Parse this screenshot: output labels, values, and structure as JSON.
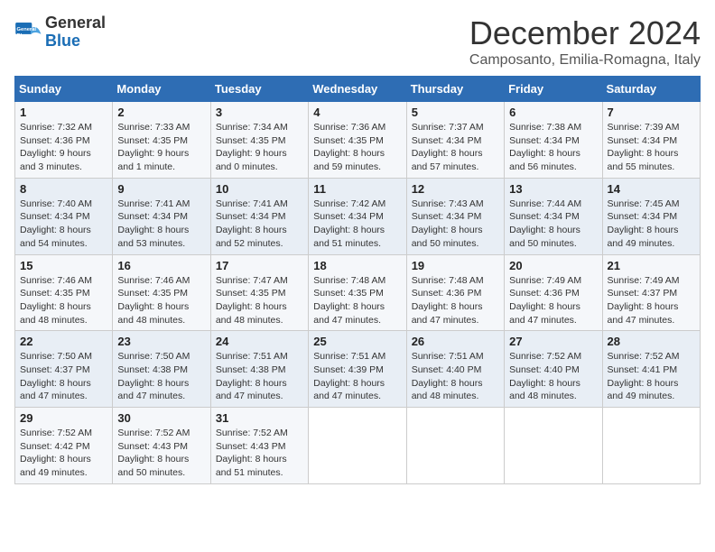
{
  "header": {
    "logo_line1": "General",
    "logo_line2": "Blue",
    "month": "December 2024",
    "location": "Camposanto, Emilia-Romagna, Italy"
  },
  "weekdays": [
    "Sunday",
    "Monday",
    "Tuesday",
    "Wednesday",
    "Thursday",
    "Friday",
    "Saturday"
  ],
  "weeks": [
    [
      {
        "day": "1",
        "info": "Sunrise: 7:32 AM\nSunset: 4:36 PM\nDaylight: 9 hours\nand 3 minutes."
      },
      {
        "day": "2",
        "info": "Sunrise: 7:33 AM\nSunset: 4:35 PM\nDaylight: 9 hours\nand 1 minute."
      },
      {
        "day": "3",
        "info": "Sunrise: 7:34 AM\nSunset: 4:35 PM\nDaylight: 9 hours\nand 0 minutes."
      },
      {
        "day": "4",
        "info": "Sunrise: 7:36 AM\nSunset: 4:35 PM\nDaylight: 8 hours\nand 59 minutes."
      },
      {
        "day": "5",
        "info": "Sunrise: 7:37 AM\nSunset: 4:34 PM\nDaylight: 8 hours\nand 57 minutes."
      },
      {
        "day": "6",
        "info": "Sunrise: 7:38 AM\nSunset: 4:34 PM\nDaylight: 8 hours\nand 56 minutes."
      },
      {
        "day": "7",
        "info": "Sunrise: 7:39 AM\nSunset: 4:34 PM\nDaylight: 8 hours\nand 55 minutes."
      }
    ],
    [
      {
        "day": "8",
        "info": "Sunrise: 7:40 AM\nSunset: 4:34 PM\nDaylight: 8 hours\nand 54 minutes."
      },
      {
        "day": "9",
        "info": "Sunrise: 7:41 AM\nSunset: 4:34 PM\nDaylight: 8 hours\nand 53 minutes."
      },
      {
        "day": "10",
        "info": "Sunrise: 7:41 AM\nSunset: 4:34 PM\nDaylight: 8 hours\nand 52 minutes."
      },
      {
        "day": "11",
        "info": "Sunrise: 7:42 AM\nSunset: 4:34 PM\nDaylight: 8 hours\nand 51 minutes."
      },
      {
        "day": "12",
        "info": "Sunrise: 7:43 AM\nSunset: 4:34 PM\nDaylight: 8 hours\nand 50 minutes."
      },
      {
        "day": "13",
        "info": "Sunrise: 7:44 AM\nSunset: 4:34 PM\nDaylight: 8 hours\nand 50 minutes."
      },
      {
        "day": "14",
        "info": "Sunrise: 7:45 AM\nSunset: 4:34 PM\nDaylight: 8 hours\nand 49 minutes."
      }
    ],
    [
      {
        "day": "15",
        "info": "Sunrise: 7:46 AM\nSunset: 4:35 PM\nDaylight: 8 hours\nand 48 minutes."
      },
      {
        "day": "16",
        "info": "Sunrise: 7:46 AM\nSunset: 4:35 PM\nDaylight: 8 hours\nand 48 minutes."
      },
      {
        "day": "17",
        "info": "Sunrise: 7:47 AM\nSunset: 4:35 PM\nDaylight: 8 hours\nand 48 minutes."
      },
      {
        "day": "18",
        "info": "Sunrise: 7:48 AM\nSunset: 4:35 PM\nDaylight: 8 hours\nand 47 minutes."
      },
      {
        "day": "19",
        "info": "Sunrise: 7:48 AM\nSunset: 4:36 PM\nDaylight: 8 hours\nand 47 minutes."
      },
      {
        "day": "20",
        "info": "Sunrise: 7:49 AM\nSunset: 4:36 PM\nDaylight: 8 hours\nand 47 minutes."
      },
      {
        "day": "21",
        "info": "Sunrise: 7:49 AM\nSunset: 4:37 PM\nDaylight: 8 hours\nand 47 minutes."
      }
    ],
    [
      {
        "day": "22",
        "info": "Sunrise: 7:50 AM\nSunset: 4:37 PM\nDaylight: 8 hours\nand 47 minutes."
      },
      {
        "day": "23",
        "info": "Sunrise: 7:50 AM\nSunset: 4:38 PM\nDaylight: 8 hours\nand 47 minutes."
      },
      {
        "day": "24",
        "info": "Sunrise: 7:51 AM\nSunset: 4:38 PM\nDaylight: 8 hours\nand 47 minutes."
      },
      {
        "day": "25",
        "info": "Sunrise: 7:51 AM\nSunset: 4:39 PM\nDaylight: 8 hours\nand 47 minutes."
      },
      {
        "day": "26",
        "info": "Sunrise: 7:51 AM\nSunset: 4:40 PM\nDaylight: 8 hours\nand 48 minutes."
      },
      {
        "day": "27",
        "info": "Sunrise: 7:52 AM\nSunset: 4:40 PM\nDaylight: 8 hours\nand 48 minutes."
      },
      {
        "day": "28",
        "info": "Sunrise: 7:52 AM\nSunset: 4:41 PM\nDaylight: 8 hours\nand 49 minutes."
      }
    ],
    [
      {
        "day": "29",
        "info": "Sunrise: 7:52 AM\nSunset: 4:42 PM\nDaylight: 8 hours\nand 49 minutes."
      },
      {
        "day": "30",
        "info": "Sunrise: 7:52 AM\nSunset: 4:43 PM\nDaylight: 8 hours\nand 50 minutes."
      },
      {
        "day": "31",
        "info": "Sunrise: 7:52 AM\nSunset: 4:43 PM\nDaylight: 8 hours\nand 51 minutes."
      },
      {
        "day": "",
        "info": ""
      },
      {
        "day": "",
        "info": ""
      },
      {
        "day": "",
        "info": ""
      },
      {
        "day": "",
        "info": ""
      }
    ]
  ]
}
